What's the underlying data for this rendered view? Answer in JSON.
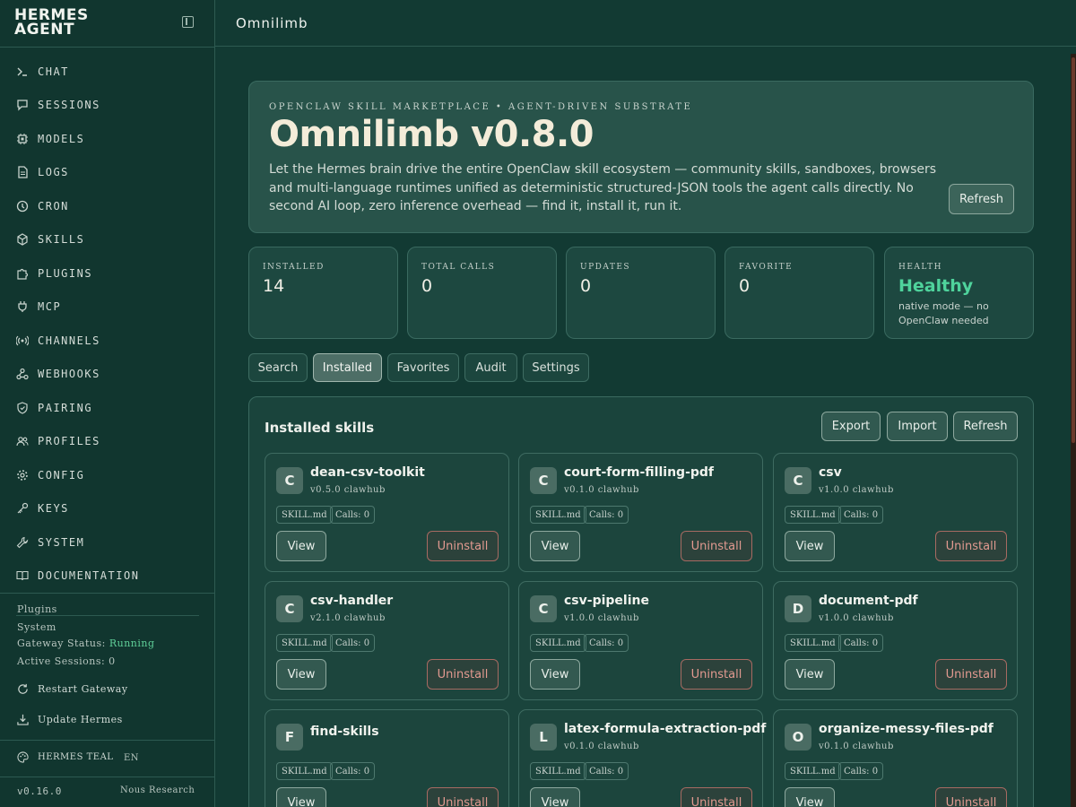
{
  "app": {
    "brand_line1": "HERMES",
    "brand_line2": "AGENT"
  },
  "sidebar": {
    "items": [
      {
        "label": "CHAT",
        "icon": "terminal-icon"
      },
      {
        "label": "SESSIONS",
        "icon": "chat-bubble-icon"
      },
      {
        "label": "MODELS",
        "icon": "chip-icon"
      },
      {
        "label": "LOGS",
        "icon": "file-icon"
      },
      {
        "label": "CRON",
        "icon": "clock-icon"
      },
      {
        "label": "SKILLS",
        "icon": "cube-icon"
      },
      {
        "label": "PLUGINS",
        "icon": "puzzle-icon"
      },
      {
        "label": "MCP",
        "icon": "plug-icon"
      },
      {
        "label": "CHANNELS",
        "icon": "broadcast-icon"
      },
      {
        "label": "WEBHOOKS",
        "icon": "webhook-icon"
      },
      {
        "label": "PAIRING",
        "icon": "shield-icon"
      },
      {
        "label": "PROFILES",
        "icon": "users-icon"
      },
      {
        "label": "CONFIG",
        "icon": "gear-icon"
      },
      {
        "label": "KEYS",
        "icon": "key-icon"
      },
      {
        "label": "SYSTEM",
        "icon": "wrench-icon"
      },
      {
        "label": "DOCUMENTATION",
        "icon": "book-icon"
      }
    ],
    "plugins_label": "Plugins",
    "system_label": "System",
    "gateway_status_label": "Gateway Status:",
    "gateway_status_value": "Running",
    "active_sessions": "Active Sessions: 0",
    "restart_label": "Restart Gateway",
    "update_label": "Update Hermes",
    "theme_label": "HERMES TEAL",
    "lang_label": "EN",
    "version": "v0.16.0",
    "org": "Nous Research"
  },
  "header": {
    "title": "Omnilimb"
  },
  "hero": {
    "kicker": "OPENCLAW SKILL MARKETPLACE • AGENT-DRIVEN SUBSTRATE",
    "title": "Omnilimb v0.8.0",
    "description": "Let the Hermes brain drive the entire OpenClaw skill ecosystem — community skills, sandboxes, browsers and multi-language runtimes unified as deterministic structured-JSON tools the agent calls directly. No second AI loop, zero inference overhead — find it, install it, run it.",
    "refresh_label": "Refresh"
  },
  "stats": [
    {
      "label": "INSTALLED",
      "value": "14"
    },
    {
      "label": "TOTAL CALLS",
      "value": "0"
    },
    {
      "label": "UPDATES",
      "value": "0"
    },
    {
      "label": "FAVORITE",
      "value": "0"
    },
    {
      "label": "HEALTH",
      "value": "Healthy",
      "sub": "native mode — no OpenClaw needed"
    }
  ],
  "tabs": [
    "Search",
    "Installed",
    "Favorites",
    "Audit",
    "Settings"
  ],
  "active_tab": "Installed",
  "panel": {
    "title": "Installed skills",
    "export_label": "Export",
    "import_label": "Import",
    "refresh_label": "Refresh"
  },
  "skills": [
    {
      "letter": "C",
      "name": "dean-csv-toolkit",
      "meta": "v0.5.0 clawhub",
      "file": "SKILL.md",
      "calls": "Calls: 0"
    },
    {
      "letter": "C",
      "name": "court-form-filling-pdf",
      "meta": "v0.1.0 clawhub",
      "file": "SKILL.md",
      "calls": "Calls: 0"
    },
    {
      "letter": "C",
      "name": "csv",
      "meta": "v1.0.0 clawhub",
      "file": "SKILL.md",
      "calls": "Calls: 0"
    },
    {
      "letter": "C",
      "name": "csv-handler",
      "meta": "v2.1.0 clawhub",
      "file": "SKILL.md",
      "calls": "Calls: 0"
    },
    {
      "letter": "C",
      "name": "csv-pipeline",
      "meta": "v1.0.0 clawhub",
      "file": "SKILL.md",
      "calls": "Calls: 0"
    },
    {
      "letter": "D",
      "name": "document-pdf",
      "meta": "v1.0.0 clawhub",
      "file": "SKILL.md",
      "calls": "Calls: 0"
    },
    {
      "letter": "F",
      "name": "find-skills",
      "meta": "",
      "file": "SKILL.md",
      "calls": "Calls: 0"
    },
    {
      "letter": "L",
      "name": "latex-formula-extraction-pdf",
      "meta": "v0.1.0 clawhub",
      "file": "SKILL.md",
      "calls": "Calls: 0"
    },
    {
      "letter": "O",
      "name": "organize-messy-files-pdf",
      "meta": "v0.1.0 clawhub",
      "file": "SKILL.md",
      "calls": "Calls: 0"
    }
  ],
  "skill_actions": {
    "view_label": "View",
    "uninstall_label": "Uninstall"
  },
  "colors": {
    "background": "#123a33",
    "healthy": "#4fd39c",
    "uninstall": "#e29a90",
    "title_cream": "#f4ecd9"
  }
}
